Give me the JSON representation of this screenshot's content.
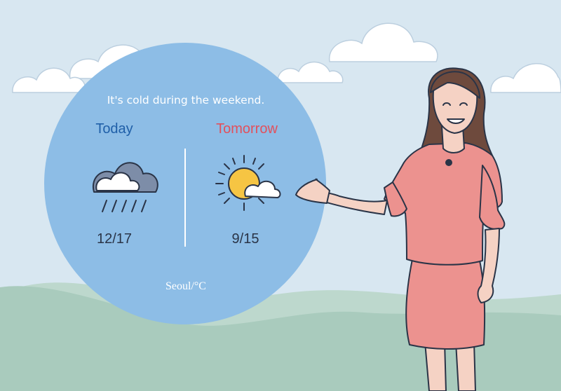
{
  "forecast": {
    "headline": "It's cold during the weekend.",
    "today": {
      "label": "Today",
      "temperature": "12/17",
      "condition_icon": "rain-cloud-icon"
    },
    "tomorrow": {
      "label": "Tomorrow",
      "temperature": "9/15",
      "condition_icon": "sun-behind-cloud-icon"
    },
    "location_unit": "Seoul/°C"
  },
  "colors": {
    "sky": "#d8e7f1",
    "bubble": "#8dbde6",
    "today_label": "#1f5fa8",
    "tomorrow_label": "#e2505c",
    "hills": "#a9cbbd",
    "dress": "#ec928f",
    "hair": "#6e4a3d"
  }
}
